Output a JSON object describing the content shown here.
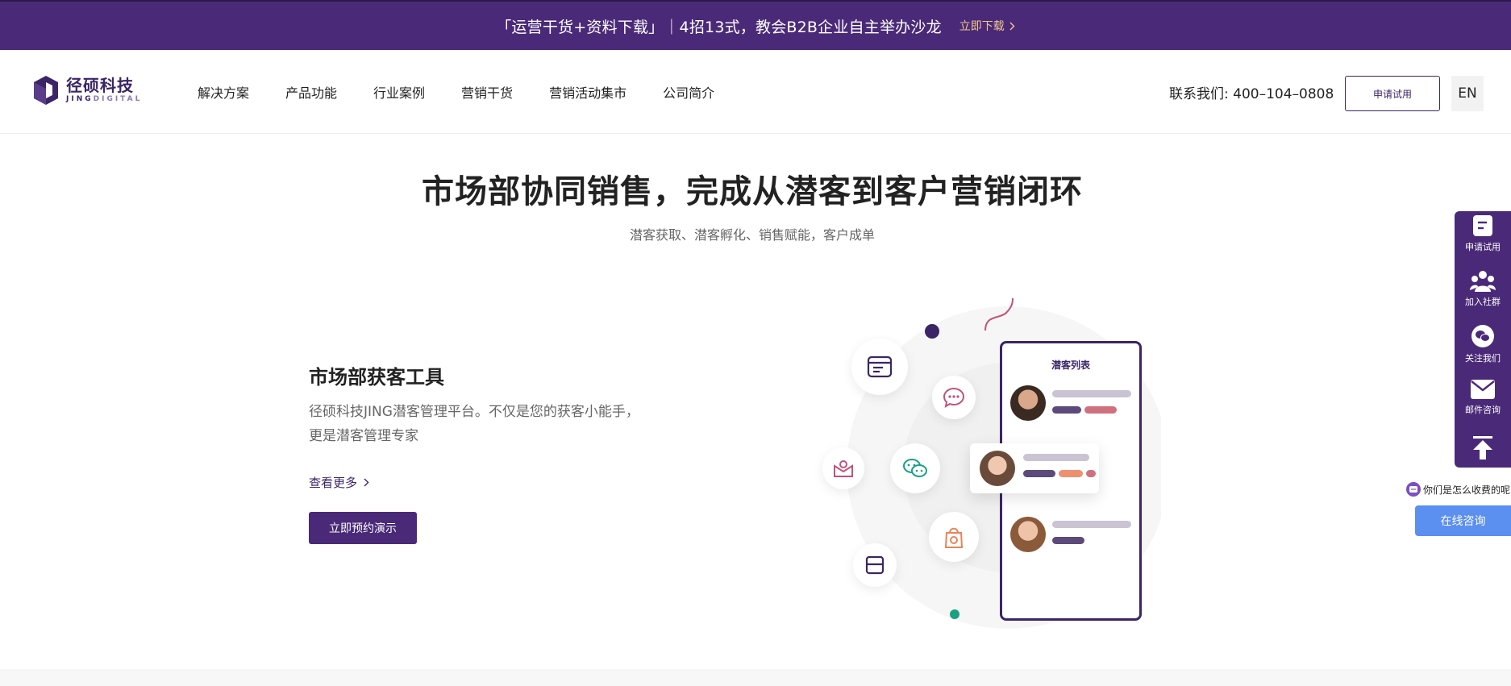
{
  "banner": {
    "text": "「运营干货+资料下载」｜4招13式，教会B2B企业自主举办沙龙",
    "link_label": "立即下载"
  },
  "header": {
    "logo_cn": "径硕科技",
    "logo_en_a": "JING",
    "logo_en_b": "DIGITAL",
    "nav": [
      {
        "label": "解决方案"
      },
      {
        "label": "产品功能"
      },
      {
        "label": "行业案例"
      },
      {
        "label": "营销干货"
      },
      {
        "label": "营销活动集市"
      },
      {
        "label": "公司简介"
      }
    ],
    "contact": "联系我们: 400–104–0808",
    "trial_label": "申请试用",
    "lang_label": "EN"
  },
  "hero": {
    "title": "市场部协同销售，完成从潜客到客户营销闭环",
    "subtitle": "潜客获取、潜客孵化、销售赋能，客户成单"
  },
  "feature": {
    "title": "市场部获客工具",
    "description": "径硕科技JING潜客管理平台。不仅是您的获客小能手，更是潜客管理专家",
    "more_label": "查看更多",
    "demo_label": "立即预约演示"
  },
  "illustration": {
    "phone_title": "潜客列表"
  },
  "sidebar": {
    "items": [
      {
        "label": "申请试用",
        "icon": "form-icon"
      },
      {
        "label": "加入社群",
        "icon": "community-icon"
      },
      {
        "label": "关注我们",
        "icon": "wechat-icon"
      },
      {
        "label": "邮件咨询",
        "icon": "mail-icon"
      }
    ]
  },
  "chat": {
    "hint": "你们是怎么收费的呢",
    "online_label": "在线咨询"
  },
  "colors": {
    "brand_purple": "#4a2a78",
    "accent_blue": "#5b8ff0",
    "banner_link": "#f0c98a"
  }
}
